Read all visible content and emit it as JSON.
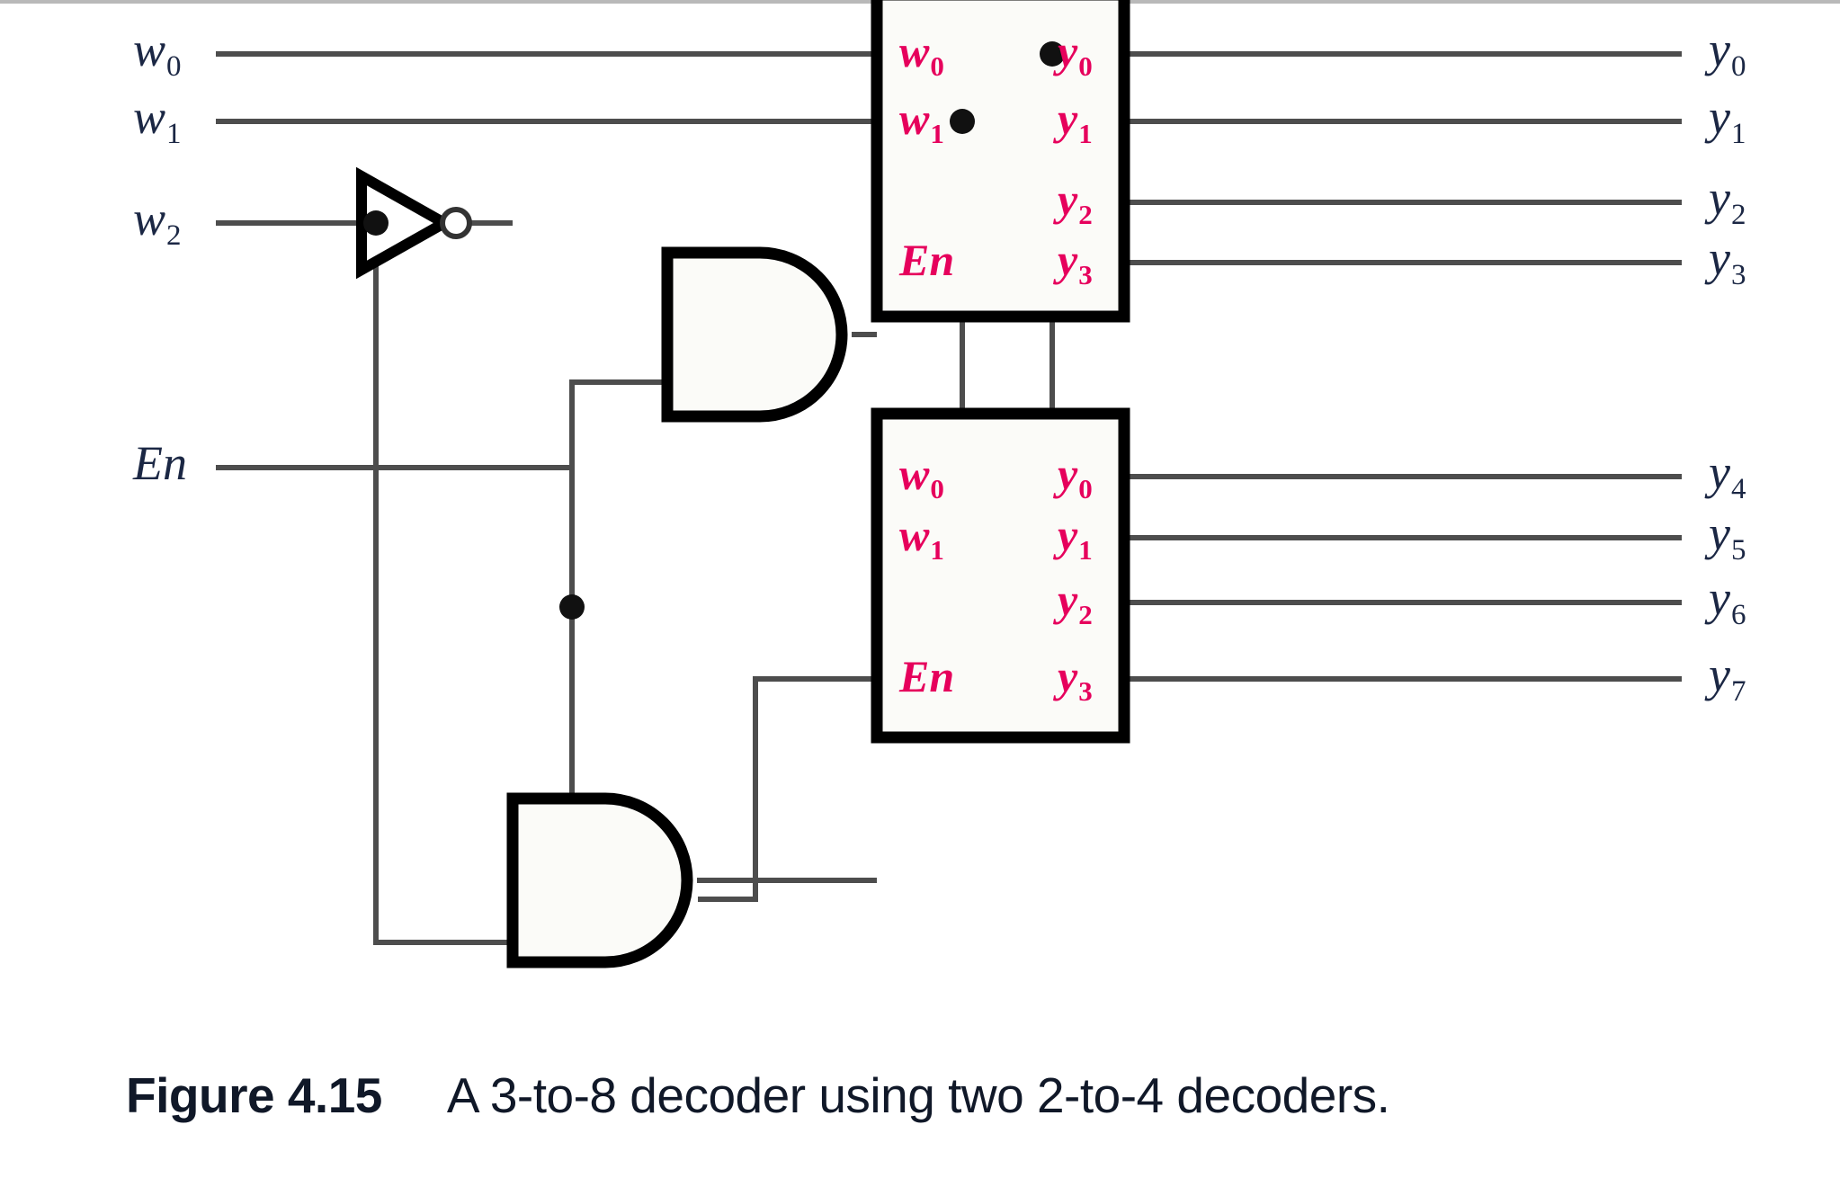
{
  "figure": {
    "number": "Figure 4.15",
    "caption": "A 3-to-8 decoder using two 2-to-4 decoders."
  },
  "colors": {
    "pin_label": "#e6005c",
    "io_label": "#1b2744",
    "wire": "#4d4d4d",
    "gate_outline": "#000000",
    "background": "#ffffff",
    "top_rule": "#b9b9b9"
  },
  "inputs": [
    {
      "name": "w0",
      "base": "w",
      "sub": "0"
    },
    {
      "name": "w1",
      "base": "w",
      "sub": "1"
    },
    {
      "name": "w2",
      "base": "w",
      "sub": "2"
    },
    {
      "name": "En",
      "base": "En",
      "sub": ""
    }
  ],
  "outputs": [
    {
      "name": "y0",
      "base": "y",
      "sub": "0"
    },
    {
      "name": "y1",
      "base": "y",
      "sub": "1"
    },
    {
      "name": "y2",
      "base": "y",
      "sub": "2"
    },
    {
      "name": "y3",
      "base": "y",
      "sub": "3"
    },
    {
      "name": "y4",
      "base": "y",
      "sub": "4"
    },
    {
      "name": "y5",
      "base": "y",
      "sub": "5"
    },
    {
      "name": "y6",
      "base": "y",
      "sub": "6"
    },
    {
      "name": "y7",
      "base": "y",
      "sub": "7"
    }
  ],
  "decoders": [
    {
      "id": "top",
      "title": "2-to-4 decoder (upper)",
      "input_pins": [
        {
          "base": "w",
          "sub": "0"
        },
        {
          "base": "w",
          "sub": "1"
        },
        {
          "base": "En",
          "sub": ""
        }
      ],
      "output_pins": [
        {
          "base": "y",
          "sub": "0"
        },
        {
          "base": "y",
          "sub": "1"
        },
        {
          "base": "y",
          "sub": "2"
        },
        {
          "base": "y",
          "sub": "3"
        }
      ]
    },
    {
      "id": "bottom",
      "title": "2-to-4 decoder (lower)",
      "input_pins": [
        {
          "base": "w",
          "sub": "0"
        },
        {
          "base": "w",
          "sub": "1"
        },
        {
          "base": "En",
          "sub": ""
        }
      ],
      "output_pins": [
        {
          "base": "y",
          "sub": "0"
        },
        {
          "base": "y",
          "sub": "1"
        },
        {
          "base": "y",
          "sub": "2"
        },
        {
          "base": "y",
          "sub": "3"
        }
      ]
    }
  ],
  "gates": [
    {
      "id": "inv",
      "type": "NOT",
      "label": "inverter on w2"
    },
    {
      "id": "and_top",
      "type": "AND",
      "label": "AND gate driving upper decoder En"
    },
    {
      "id": "and_bottom",
      "type": "AND",
      "label": "AND gate driving lower decoder En"
    }
  ],
  "labels": {
    "in_w0": "w",
    "in_w0_sub": "0",
    "in_w1": "w",
    "in_w1_sub": "1",
    "in_w2": "w",
    "in_w2_sub": "2",
    "in_en": "En",
    "out_y0": "y",
    "out_y0_sub": "0",
    "out_y1": "y",
    "out_y1_sub": "1",
    "out_y2": "y",
    "out_y2_sub": "2",
    "out_y3": "y",
    "out_y3_sub": "3",
    "out_y4": "y",
    "out_y4_sub": "4",
    "out_y5": "y",
    "out_y5_sub": "5",
    "out_y6": "y",
    "out_y6_sub": "6",
    "out_y7": "y",
    "out_y7_sub": "7",
    "pin_w": "w",
    "pin_y": "y",
    "pin_en": "En",
    "sub0": "0",
    "sub1": "1",
    "sub2": "2",
    "sub3": "3"
  }
}
